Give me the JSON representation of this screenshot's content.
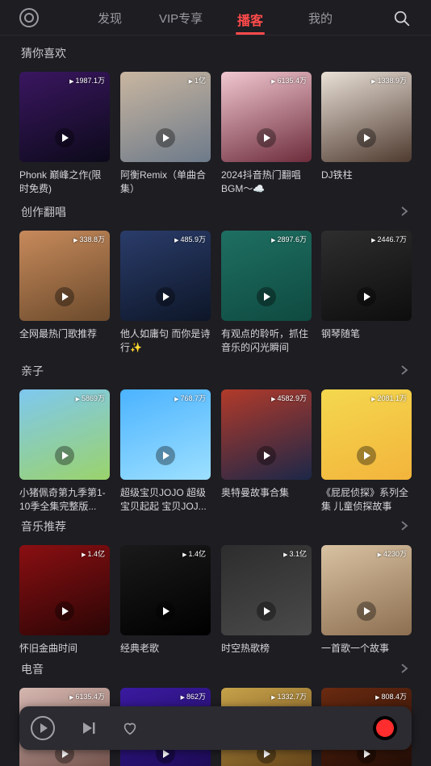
{
  "nav": {
    "tabs": [
      {
        "label": "发现"
      },
      {
        "label": "VIP专享"
      },
      {
        "label": "播客"
      },
      {
        "label": "我的"
      }
    ]
  },
  "sections": [
    {
      "title": "猜你喜欢",
      "items": [
        {
          "plays": "1987.1万",
          "caption": "Phonk 巅峰之作(限时免费)",
          "colors": [
            "#3a1660",
            "#0c0a1a"
          ]
        },
        {
          "plays": "1亿",
          "caption": "阿衡Remix（单曲合集）",
          "colors": [
            "#c9b6a0",
            "#6d7a8a"
          ]
        },
        {
          "plays": "6135.4万",
          "caption": "2024抖音热门翻唱BGM～☁️",
          "colors": [
            "#f1c7d0",
            "#6d2c3b"
          ]
        },
        {
          "plays": "1338.9万",
          "caption": "DJ铁柱",
          "colors": [
            "#e9e0d6",
            "#4f3b30"
          ]
        }
      ]
    },
    {
      "title": "创作翻唱",
      "items": [
        {
          "plays": "338.8万",
          "caption": "全网最热门歌推荐",
          "colors": [
            "#c78a5b",
            "#6b4a2c"
          ]
        },
        {
          "plays": "485.9万",
          "caption": "他人如庸句 而你是诗行✨",
          "colors": [
            "#2a3c6a",
            "#0d1628"
          ]
        },
        {
          "plays": "2897.6万",
          "caption": "有观点的聆听，抓住音乐的闪光瞬间",
          "colors": [
            "#1e6f62",
            "#0f4a40"
          ]
        },
        {
          "plays": "2446.7万",
          "caption": "钢琴随笔",
          "colors": [
            "#2e2e2e",
            "#0d0d0d"
          ]
        }
      ]
    },
    {
      "title": "亲子",
      "items": [
        {
          "plays": "5869万",
          "caption": "小猪佩奇第九季第1-10季全集完整版...",
          "colors": [
            "#7ec8f0",
            "#9bd36b"
          ]
        },
        {
          "plays": "768.7万",
          "caption": "超级宝贝JOJO 超级宝贝起起 宝贝JOJ...",
          "colors": [
            "#4bb3ff",
            "#9de0ff"
          ]
        },
        {
          "plays": "4582.9万",
          "caption": "奥特曼故事合集",
          "colors": [
            "#b23a2a",
            "#1c2748"
          ]
        },
        {
          "plays": "2081.1万",
          "caption": "《屁屁侦探》系列全集 儿童侦探故事",
          "colors": [
            "#f4d84e",
            "#f3b43c"
          ]
        }
      ]
    },
    {
      "title": "音乐推荐",
      "items": [
        {
          "plays": "1.4亿",
          "caption": "怀旧金曲时间",
          "colors": [
            "#8a0f12",
            "#2a0505"
          ]
        },
        {
          "plays": "1.4亿",
          "caption": "经典老歌",
          "colors": [
            "#1a1a1a",
            "#000000"
          ]
        },
        {
          "plays": "3.1亿",
          "caption": "时空热歌榜",
          "colors": [
            "#2d2d2d",
            "#4a4a4a"
          ]
        },
        {
          "plays": "4230万",
          "caption": "一首歌一个故事",
          "colors": [
            "#d8c2a2",
            "#8c6e50"
          ]
        }
      ]
    },
    {
      "title": "电音",
      "items": [
        {
          "plays": "6135.4万",
          "caption": "",
          "colors": [
            "#d6b7b0",
            "#6b4a44"
          ]
        },
        {
          "plays": "862万",
          "caption": "",
          "colors": [
            "#3a1aa0",
            "#1a0a50"
          ]
        },
        {
          "plays": "1332.7万",
          "caption": "",
          "colors": [
            "#c7a24a",
            "#5b3b14"
          ]
        },
        {
          "plays": "808.4万",
          "caption": "",
          "colors": [
            "#6a2a10",
            "#1a0a05"
          ]
        }
      ]
    }
  ]
}
